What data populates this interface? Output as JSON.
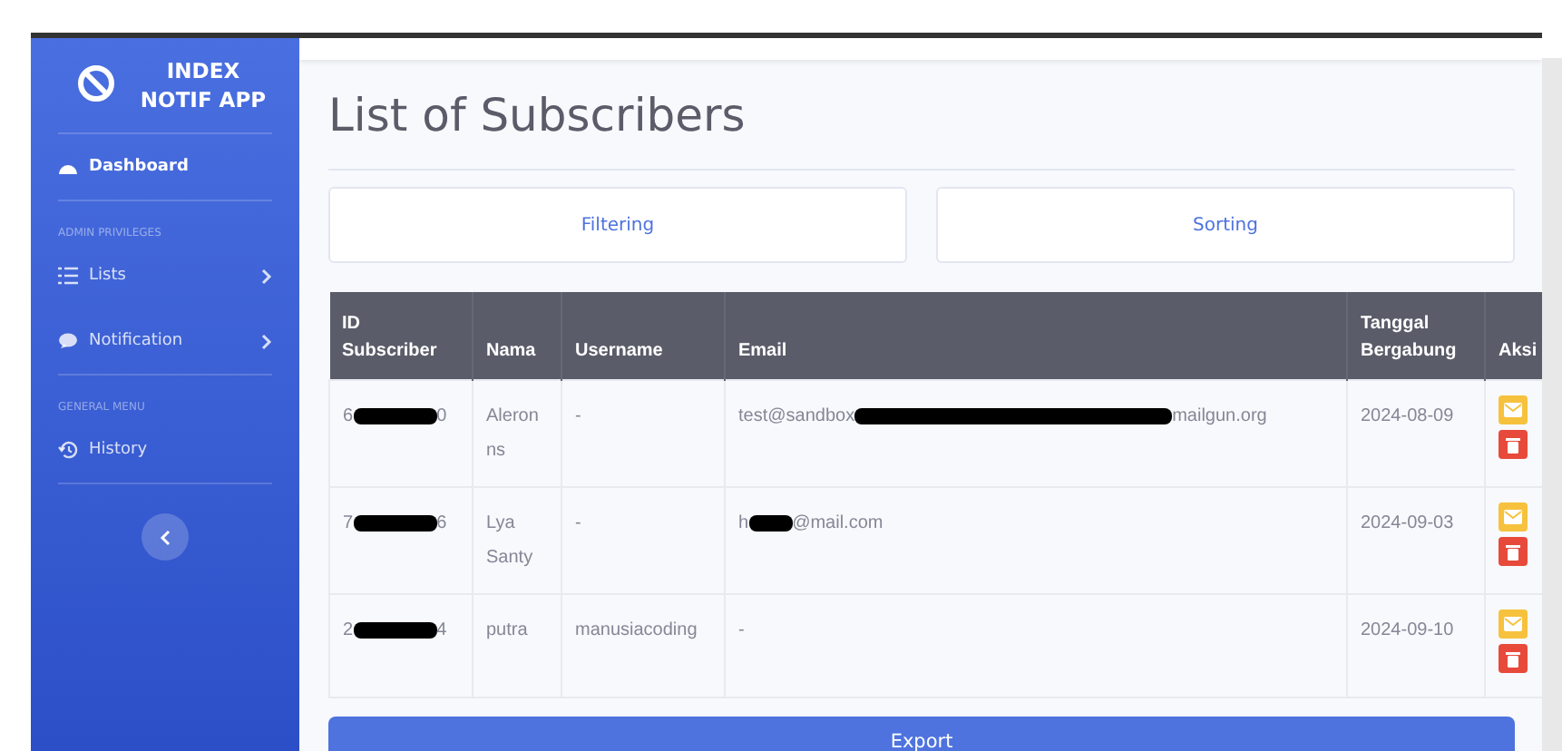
{
  "sidebar": {
    "brand": "INDEX NOTIF APP",
    "sections": [
      {
        "items": [
          {
            "label": "Dashboard",
            "kind": "link",
            "selected": true
          }
        ]
      },
      {
        "heading": "ADMIN PRIVILEGES",
        "items": [
          {
            "label": "Lists",
            "kind": "dropdown",
            "selected": false
          },
          {
            "label": "Notification",
            "kind": "dropdown",
            "selected": false
          }
        ]
      },
      {
        "heading": "GENERAL MENU",
        "items": [
          {
            "label": "History",
            "kind": "link",
            "selected": false
          }
        ]
      }
    ]
  },
  "page": {
    "title": "List of Subscribers",
    "tools": [
      "Filtering",
      "Sorting"
    ],
    "export_button": "Export"
  },
  "table": {
    "columns": [
      "ID Subscriber",
      "Nama",
      "Username",
      "Email",
      "Tanggal Bergabung",
      "Aksi"
    ],
    "rows": [
      {
        "id": [
          "6",
          "0"
        ],
        "nama": "Aleronns",
        "username": "-",
        "email": [
          "test@sandbox",
          "mailgun.org"
        ],
        "joined": "2024-08-09"
      },
      {
        "id": [
          "7",
          "6"
        ],
        "nama": "Lya Santy",
        "username": "-",
        "email": [
          "h",
          "@mail.com"
        ],
        "joined": "2024-09-03"
      },
      {
        "id": [
          "2",
          "4"
        ],
        "nama": "putra",
        "username": "manusiacoding",
        "email": [
          "-"
        ],
        "joined": "2024-09-10"
      }
    ]
  }
}
